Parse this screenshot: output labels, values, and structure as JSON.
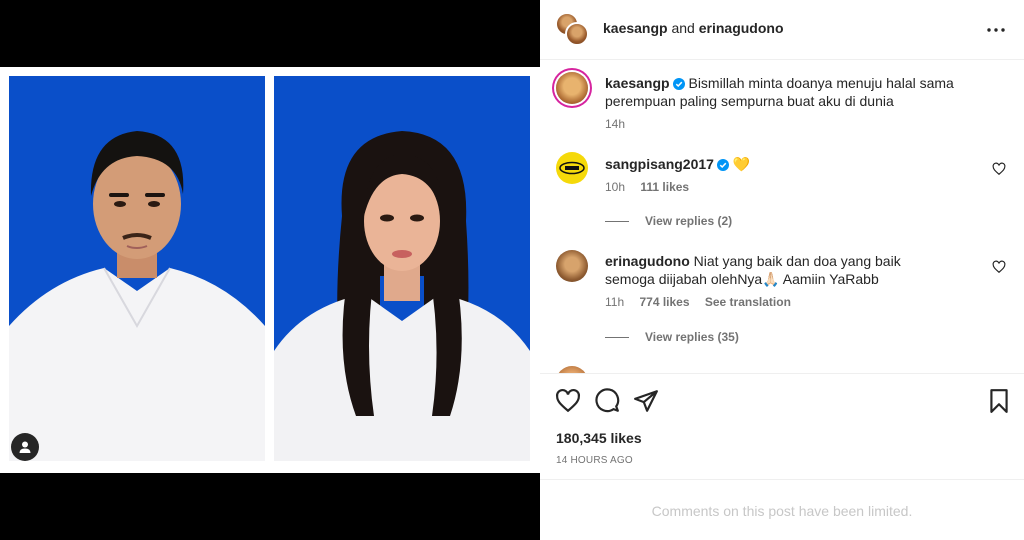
{
  "header": {
    "user1": "kaesangp",
    "conjunction": "and",
    "user2": "erinagudono"
  },
  "caption": {
    "user": "kaesangp",
    "text": "Bismillah minta doanya menuju halal sama perempuan paling sempurna buat aku di dunia",
    "time": "14h"
  },
  "comments": [
    {
      "user": "sangpisang2017",
      "text": "💛",
      "time": "10h",
      "likes": "111 likes",
      "replies": "View replies (2)"
    },
    {
      "user": "erinagudono",
      "text": "Niat yang baik dan doa yang baik semoga diijabah olehNya🙏🏻 Aamiin YaRabb",
      "time": "11h",
      "likes": "774 likes",
      "translate": "See translation",
      "replies": "View replies (35)"
    }
  ],
  "post": {
    "likes": "180,345 likes",
    "time_ago": "14 HOURS AGO",
    "limited_notice": "Comments on this post have been limited."
  },
  "icons": [
    "tag-user-icon",
    "more-icon",
    "verified-icon",
    "heart-icon",
    "comment-icon",
    "share-icon",
    "bookmark-icon"
  ],
  "colors": {
    "verified": "#0095f6",
    "photo_background": "#0a4fc9",
    "muted_text": "#737373"
  }
}
